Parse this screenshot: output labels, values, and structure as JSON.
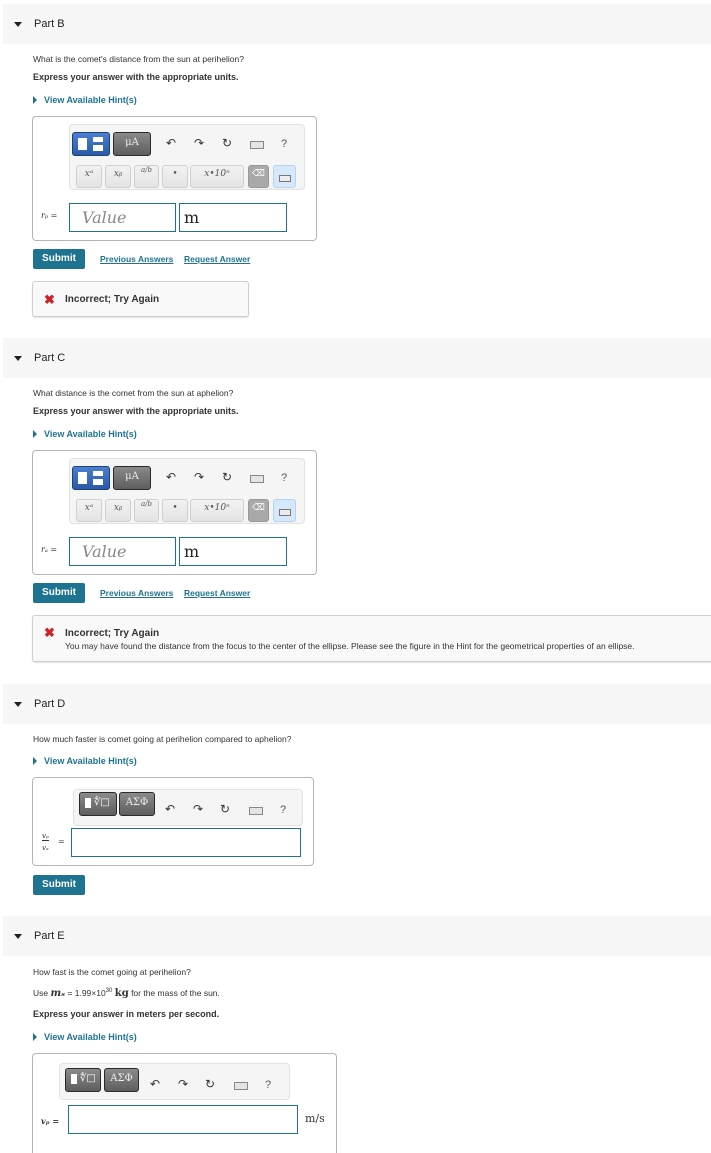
{
  "parts": {
    "B": {
      "title": "Part B",
      "question": "What is the comet's distance from the sun at perihelion?",
      "instruction": "Express your answer with the appropriate units.",
      "hint_label": "View Available Hint(s)",
      "var_label": "rₚ =",
      "value_placeholder": "Value",
      "unit_value": "m",
      "submit_label": "Submit",
      "previous_answers_label": "Previous Answers",
      "request_answer_label": "Request Answer",
      "feedback_title": "Incorrect; Try Again"
    },
    "C": {
      "title": "Part C",
      "question": "What distance is the comet from the sun at aphelion?",
      "instruction": "Express your answer with the appropriate units.",
      "hint_label": "View Available Hint(s)",
      "var_label": "rₐ =",
      "value_placeholder": "Value",
      "unit_value": "m",
      "submit_label": "Submit",
      "previous_answers_label": "Previous Answers",
      "request_answer_label": "Request Answer",
      "feedback_title": "Incorrect; Try Again",
      "feedback_message": "You may have found the distance from the focus to the center of the ellipse. Please see the figure in the Hint for the geometrical properties of an ellipse."
    },
    "D": {
      "title": "Part D",
      "question": "How much faster is comet going at perihelion compared to aphelion?",
      "hint_label": "View Available Hint(s)",
      "var_num": "vₚ",
      "var_den": "vₐ",
      "equals": "=",
      "input_value": "",
      "submit_label": "Submit"
    },
    "E": {
      "title": "Part E",
      "question": "How fast is the comet going at perihelion?",
      "given_prefix": "Use",
      "given_symbol": "mₛ",
      "given_value": "= 1.99×10",
      "given_exp": "30",
      "given_unit": "kg",
      "given_suffix": "for the mass of the sun.",
      "instruction": "Express your answer in meters per second.",
      "hint_label": "View Available Hint(s)",
      "var_label": "vₚ =",
      "input_value": "",
      "unit": "m/s"
    }
  },
  "toolbar": {
    "templates_label": "templates",
    "symbols_units_label": "μA",
    "greek_label": "ΑΣΦ",
    "undo_icon": "↶",
    "redo_icon": "↷",
    "reset_icon": "↻",
    "help_label": "?",
    "key_superscript": "xᵃ",
    "key_subscript": "xᵦ",
    "key_fraction": "a/b",
    "key_dot": "•",
    "key_sci": "x•10ⁿ"
  },
  "colors": {
    "accent": "#1e7390",
    "error": "#d0202a",
    "header_bg": "#f7f7f7"
  }
}
